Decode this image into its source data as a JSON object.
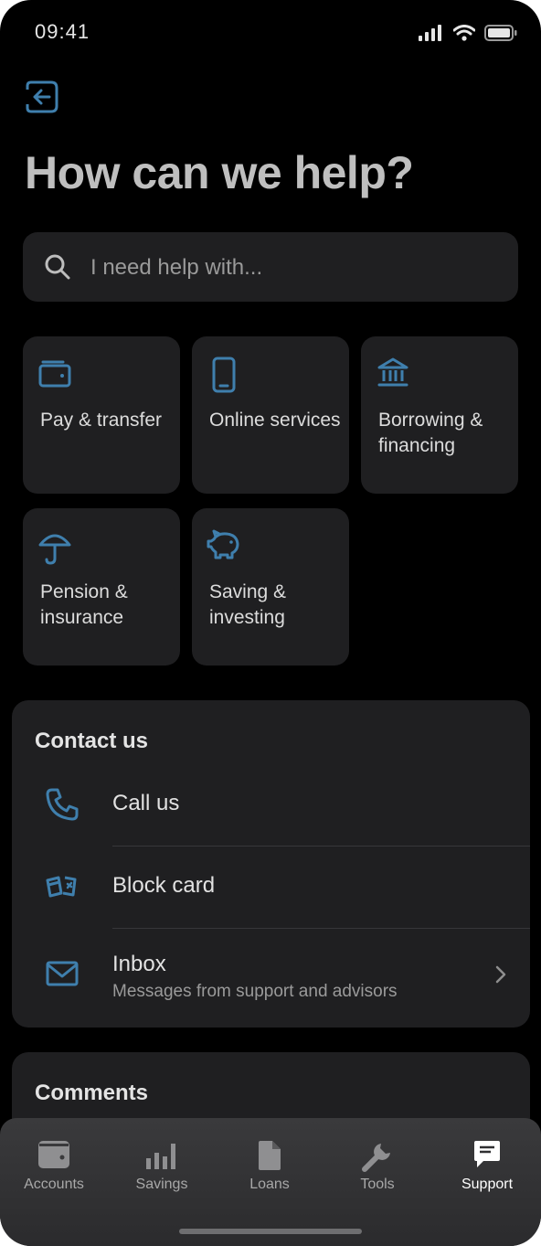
{
  "status_bar": {
    "time": "09:41"
  },
  "header": {
    "title": "How can we help?"
  },
  "search": {
    "placeholder": "I need help with..."
  },
  "topics": [
    {
      "label": "Pay & transfer",
      "icon": "wallet-icon"
    },
    {
      "label": "Online services",
      "icon": "smartphone-icon"
    },
    {
      "label": "Borrowing & financing",
      "icon": "bank-icon"
    },
    {
      "label": "Pension & insurance",
      "icon": "umbrella-icon"
    },
    {
      "label": "Saving & investing",
      "icon": "piggy-bank-icon"
    }
  ],
  "contact": {
    "title": "Contact us",
    "items": [
      {
        "label": "Call us",
        "icon": "phone-icon"
      },
      {
        "label": "Block card",
        "icon": "block-card-icon"
      },
      {
        "label": "Inbox",
        "sublabel": "Messages from support and advisors",
        "icon": "mail-icon"
      }
    ]
  },
  "comments": {
    "title": "Comments"
  },
  "tabbar": {
    "active": "Support",
    "tabs": [
      {
        "label": "Accounts",
        "icon": "wallet-icon"
      },
      {
        "label": "Savings",
        "icon": "bar-chart-icon"
      },
      {
        "label": "Loans",
        "icon": "document-icon"
      },
      {
        "label": "Tools",
        "icon": "wrench-icon"
      },
      {
        "label": "Support",
        "icon": "chat-icon"
      }
    ]
  },
  "colors": {
    "accent": "#3f7fad",
    "background": "#000000",
    "card": "#1f1f21"
  }
}
